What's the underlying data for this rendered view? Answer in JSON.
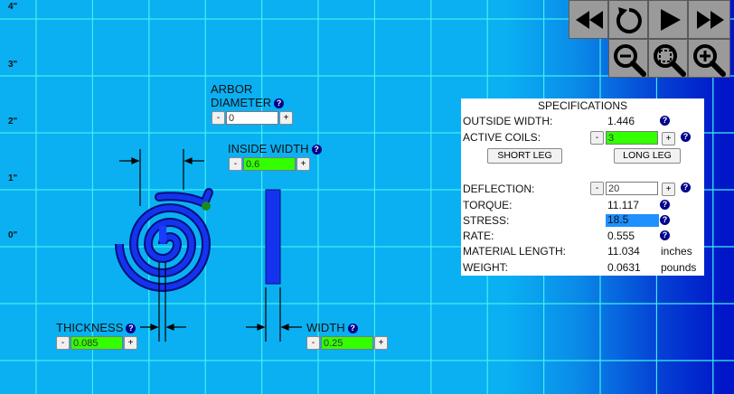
{
  "y_axis_labels": [
    "4\"",
    "3\"",
    "2\"",
    "1\"",
    "0\""
  ],
  "arbor_diameter": {
    "label_line1": "ARBOR",
    "label_line2": "DIAMETER",
    "value": "0",
    "minus": "-",
    "plus": "+",
    "help": "?"
  },
  "inside_width": {
    "label": "INSIDE WIDTH",
    "value": "0.6",
    "minus": "-",
    "plus": "+",
    "help": "?"
  },
  "thickness": {
    "label": "THICKNESS",
    "value": "0.085",
    "minus": "-",
    "plus": "+",
    "help": "?"
  },
  "width": {
    "label": "WIDTH",
    "value": "0.25",
    "minus": "-",
    "plus": "+",
    "help": "?"
  },
  "specifications": {
    "title": "SPECIFICATIONS",
    "outside_width_label": "OUTSIDE WIDTH:",
    "outside_width_value": "1.446",
    "active_coils_label": "ACTIVE COILS:",
    "active_coils_value": "3",
    "short_leg": "SHORT LEG",
    "long_leg": "LONG LEG",
    "deflection_label": "DEFLECTION:",
    "deflection_value": "20",
    "torque_label": "TORQUE:",
    "torque_value": "11.117",
    "stress_label": "STRESS:",
    "stress_value": "18.5",
    "rate_label": "RATE:",
    "rate_value": "0.555",
    "material_length_label": "MATERIAL LENGTH:",
    "material_length_value": "11.034",
    "material_length_unit": "inches",
    "weight_label": "WEIGHT:",
    "weight_value": "0.0631",
    "weight_unit": "pounds",
    "minus": "-",
    "plus": "+",
    "help": "?"
  },
  "colors": {
    "background": "#0ab0f2",
    "grid": "#3ff0f0",
    "field_green": "#33ff00",
    "stress_highlight": "#1e90ff",
    "spring": "#0a1fd9"
  },
  "controls": [
    "rewind-icon",
    "reset-icon",
    "play-icon",
    "fast-forward-icon",
    "zoom-out-icon",
    "zoom-fit-icon",
    "zoom-in-icon"
  ]
}
